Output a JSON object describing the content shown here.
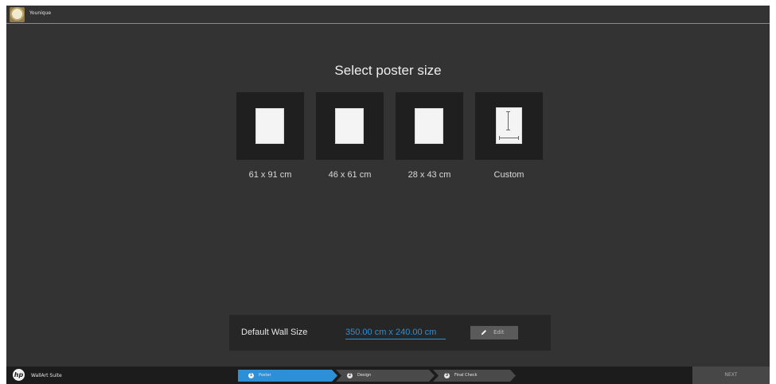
{
  "header": {
    "user_name": "Younique",
    "avatar_icon": "user-avatar-icon"
  },
  "main": {
    "title": "Select poster size",
    "sizes": [
      {
        "label": "61 x 91 cm",
        "icon": "poster-sheet-icon"
      },
      {
        "label": "46 x 61 cm",
        "icon": "poster-sheet-icon"
      },
      {
        "label": "28 x 43 cm",
        "icon": "poster-sheet-icon"
      },
      {
        "label": "Custom",
        "icon": "custom-size-icon"
      }
    ]
  },
  "wall": {
    "label": "Default Wall Size",
    "value": "350.00 cm  x  240.00 cm",
    "edit_label": "Edit",
    "edit_icon": "pencil-icon"
  },
  "footer": {
    "logo_text": "hp",
    "suite_name": "WallArt Suite",
    "steps": [
      {
        "number": "1",
        "label": "Poster",
        "active": true
      },
      {
        "number": "2",
        "label": "Design",
        "active": false
      },
      {
        "number": "3",
        "label": "Final Check",
        "active": false
      }
    ],
    "next_label": "NEXT"
  },
  "colors": {
    "background": "#333333",
    "accent": "#2d8fd5",
    "card": "#1f1f1f",
    "step_inactive": "#4a4a4a"
  }
}
